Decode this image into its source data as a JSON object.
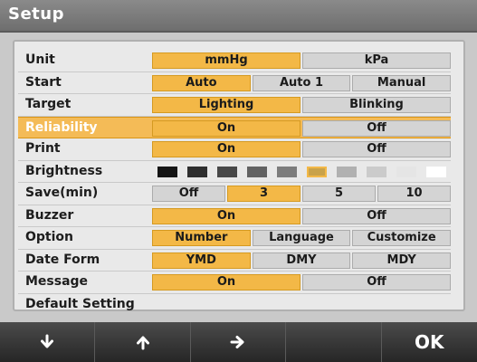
{
  "title": "Setup",
  "rows": [
    {
      "label": "Unit",
      "options": [
        "mmHg",
        "kPa"
      ],
      "selected": 0
    },
    {
      "label": "Start",
      "options": [
        "Auto",
        "Auto  1",
        "Manual"
      ],
      "selected": 0
    },
    {
      "label": "Target",
      "options": [
        "Lighting",
        "Blinking"
      ],
      "selected": 0
    },
    {
      "label": "Reliability",
      "options": [
        "On",
        "Off"
      ],
      "selected": 0
    },
    {
      "label": "Print",
      "options": [
        "On",
        "Off"
      ],
      "selected": 0
    },
    {
      "label": "Brightness",
      "levels": 10,
      "selected_level": 6
    },
    {
      "label": "Save(min)",
      "options": [
        "Off",
        "3",
        "5",
        "10"
      ],
      "selected": 1
    },
    {
      "label": "Buzzer",
      "options": [
        "On",
        "Off"
      ],
      "selected": 0
    },
    {
      "label": "Option",
      "options": [
        "Number",
        "Language",
        "Customize"
      ],
      "selected": 0
    },
    {
      "label": "Date Form",
      "options": [
        "YMD",
        "DMY",
        "MDY"
      ],
      "selected": 0
    },
    {
      "label": "Message",
      "options": [
        "On",
        "Off"
      ],
      "selected": 0
    },
    {
      "label": "Default Setting"
    }
  ],
  "highlighted_row": 3,
  "softkeys": [
    {
      "icon": "arrow-down-icon"
    },
    {
      "icon": "arrow-up-icon"
    },
    {
      "icon": "arrow-right-icon"
    },
    {
      "icon": "blank"
    },
    {
      "label": "OK"
    }
  ],
  "colors": {
    "accent": "#f3b847",
    "row_highlight": "#f4bb57",
    "title_bar": "#7b7b7b",
    "bottom_bar": "#333333"
  }
}
